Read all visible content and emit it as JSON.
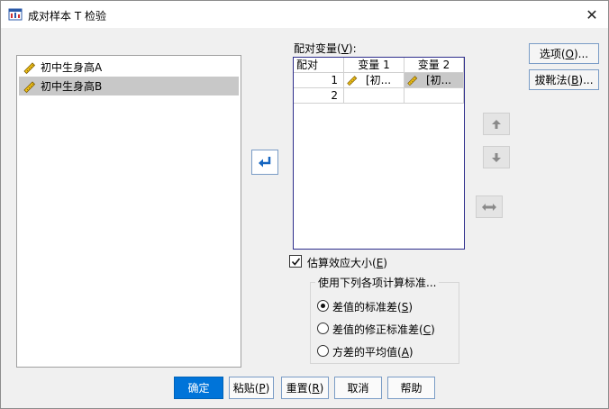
{
  "window": {
    "title": "成对样本 T 检验",
    "close_symbol": "✕"
  },
  "source_list": {
    "items": [
      {
        "label": "初中生身高A",
        "selected": false,
        "icon": "scale-ruler-icon"
      },
      {
        "label": "初中生身高B",
        "selected": true,
        "icon": "scale-ruler-icon"
      }
    ]
  },
  "move_button": {
    "icon": "arrow-move-icon"
  },
  "paired_vars": {
    "label_prefix": "配对变量(",
    "mnemonic": "V",
    "label_suffix": "):",
    "headers": [
      "配对",
      "变量 1",
      "变量 2"
    ],
    "rows": [
      {
        "num": "1",
        "var1": "[初...",
        "var2": "[初...",
        "var2_selected": true
      },
      {
        "num": "2",
        "var1": "",
        "var2": ""
      }
    ]
  },
  "side_buttons": {
    "options_prefix": "选项(",
    "options_key": "O",
    "options_suffix": ")...",
    "bootstrap_prefix": "拔靴法(",
    "bootstrap_key": "B",
    "bootstrap_suffix": ")..."
  },
  "order_buttons": {
    "up_icon": "arrow-up-icon",
    "down_icon": "arrow-down-icon",
    "swap_icon": "swap-icon"
  },
  "effect_size": {
    "checked": true,
    "label_prefix": "估算效应大小(",
    "key": "E",
    "label_suffix": ")"
  },
  "standardizer": {
    "title": "使用下列各项计算标准...",
    "options": [
      {
        "prefix": "差值的标准差(",
        "key": "S",
        "suffix": ")",
        "checked": true
      },
      {
        "prefix": "差值的修正标准差(",
        "key": "C",
        "suffix": ")",
        "checked": false
      },
      {
        "prefix": "方差的平均值(",
        "key": "A",
        "suffix": ")",
        "checked": false
      }
    ]
  },
  "bottom_buttons": {
    "ok": "确定",
    "paste_prefix": "粘贴(",
    "paste_key": "P",
    "paste_suffix": ")",
    "reset_prefix": "重置(",
    "reset_key": "R",
    "reset_suffix": ")",
    "cancel": "取消",
    "help": "帮助"
  },
  "colors": {
    "accent": "#0074d9",
    "selected_row": "#c8c8c8",
    "pair_border": "#2d2d8c"
  }
}
